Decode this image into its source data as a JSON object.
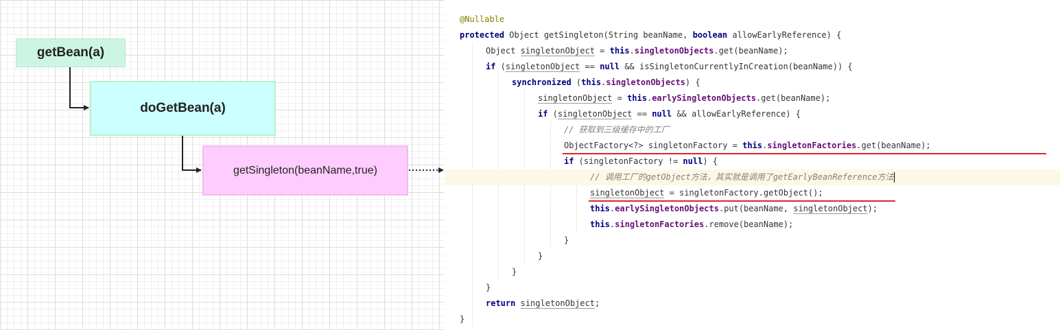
{
  "diagram": {
    "nodes": {
      "get_bean": "getBean(a)",
      "do_get_bean": "doGetBean(a)",
      "get_singleton": "getSingleton(beanName,true)"
    },
    "colors": {
      "get_bean_fill": "#ccf5e4",
      "do_get_bean_fill": "#ccffff",
      "get_singleton_fill": "#ffccff",
      "grid": "#dcdcdc"
    }
  },
  "code": {
    "lines": [
      [
        {
          "t": "@Nullable",
          "c": "ann"
        }
      ],
      [
        {
          "t": "protected",
          "c": "kw"
        },
        {
          "t": " Object getSingleton(String beanName, "
        },
        {
          "t": "boolean",
          "c": "kw"
        },
        {
          "t": " allowEarlyReference) {"
        }
      ],
      [
        {
          "t": "Object "
        },
        {
          "t": "singletonObject",
          "c": "uv"
        },
        {
          "t": " = "
        },
        {
          "t": "this",
          "c": "kw"
        },
        {
          "t": "."
        },
        {
          "t": "singletonObjects",
          "c": "field"
        },
        {
          "t": ".get(beanName);"
        }
      ],
      [
        {
          "t": "if",
          "c": "kw"
        },
        {
          "t": " ("
        },
        {
          "t": "singletonObject",
          "c": "uv"
        },
        {
          "t": " == "
        },
        {
          "t": "null",
          "c": "kw"
        },
        {
          "t": " && isSingletonCurrentlyInCreation(beanName)) {"
        }
      ],
      [
        {
          "t": "synchronized",
          "c": "kw"
        },
        {
          "t": " ("
        },
        {
          "t": "this",
          "c": "kw"
        },
        {
          "t": "."
        },
        {
          "t": "singletonObjects",
          "c": "field"
        },
        {
          "t": ") {"
        }
      ],
      [
        {
          "t": "singletonObject",
          "c": "uv"
        },
        {
          "t": " = "
        },
        {
          "t": "this",
          "c": "kw"
        },
        {
          "t": "."
        },
        {
          "t": "earlySingletonObjects",
          "c": "field"
        },
        {
          "t": ".get(beanName);"
        }
      ],
      [
        {
          "t": "if",
          "c": "kw"
        },
        {
          "t": " ("
        },
        {
          "t": "singletonObject",
          "c": "uv"
        },
        {
          "t": " == "
        },
        {
          "t": "null",
          "c": "kw"
        },
        {
          "t": " && allowEarlyReference) {"
        }
      ],
      [
        {
          "t": "// 获取到三级缓存中的工厂",
          "c": "cmt"
        }
      ],
      [
        {
          "t": "ObjectFactory<?> singletonFactory = "
        },
        {
          "t": "this",
          "c": "kw"
        },
        {
          "t": "."
        },
        {
          "t": "singletonFactories",
          "c": "field"
        },
        {
          "t": ".get(beanName);"
        }
      ],
      [
        {
          "t": "if",
          "c": "kw"
        },
        {
          "t": " (singletonFactory != "
        },
        {
          "t": "null",
          "c": "kw"
        },
        {
          "t": ") {"
        }
      ],
      [
        {
          "t": "// 调用工厂的getObject方法，其实就是调用了getEarlyBeanReference方法",
          "c": "cmt"
        }
      ],
      [
        {
          "t": "singletonObject",
          "c": "uv"
        },
        {
          "t": " = singletonFactory.getObject();"
        }
      ],
      [
        {
          "t": "this",
          "c": "kw"
        },
        {
          "t": "."
        },
        {
          "t": "earlySingletonObjects",
          "c": "field"
        },
        {
          "t": ".put(beanName, "
        },
        {
          "t": "singletonObject",
          "c": "uv"
        },
        {
          "t": ");"
        }
      ],
      [
        {
          "t": "this",
          "c": "kw"
        },
        {
          "t": "."
        },
        {
          "t": "singletonFactories",
          "c": "field"
        },
        {
          "t": ".remove(beanName);"
        }
      ],
      [
        {
          "t": "}"
        }
      ],
      [
        {
          "t": "}"
        }
      ],
      [
        {
          "t": "}"
        }
      ],
      [
        {
          "t": "}"
        }
      ],
      [
        {
          "t": "return",
          "c": "kw"
        },
        {
          "t": " "
        },
        {
          "t": "singletonObject",
          "c": "uv"
        },
        {
          "t": ";"
        }
      ],
      [
        {
          "t": "}"
        }
      ]
    ]
  }
}
